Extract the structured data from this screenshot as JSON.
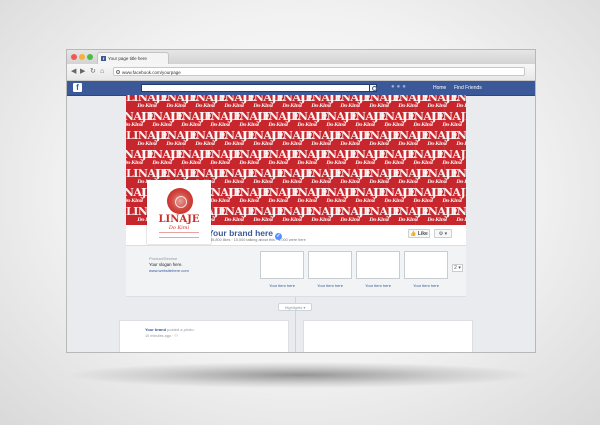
{
  "browser": {
    "tab_title": "Your page title here",
    "url": "www.facebook.com/yourpage",
    "nav_buttons": [
      "back",
      "forward",
      "reload",
      "home"
    ]
  },
  "facebook": {
    "logo": "f",
    "nav": {
      "home": "Home",
      "find_friends": "Find Friends"
    },
    "icons": [
      "friends-icon",
      "messages-icon",
      "notifications-icon",
      "settings-icon"
    ]
  },
  "cover": {
    "logo_text": "LINAJE",
    "logo_sub": "Do Kimi"
  },
  "profile": {
    "logo_text": "LINAJE",
    "logo_sub": "Do Kimi",
    "name": "Your brand here",
    "verified_mark": "✓",
    "stats": "135,800 likes · 10,000 talking about this · 1,000 were here",
    "like_label": "Like",
    "like_icon": "👍",
    "menu_label": "⚙ ▾"
  },
  "about": {
    "category": "Product/Service",
    "slogan": "Your slogan here.",
    "website": "www.websitehere.com"
  },
  "items": [
    {
      "caption": "Your item here"
    },
    {
      "caption": "Your item here"
    },
    {
      "caption": "Your item here"
    },
    {
      "caption": "Your item here"
    }
  ],
  "items_menu": "2 ▾",
  "timeline": {
    "highlights_label": "Highlights ▾",
    "post": {
      "author": "Your brand",
      "action": "posted a photo.",
      "time": "10 minutes ago · ⚇"
    }
  }
}
